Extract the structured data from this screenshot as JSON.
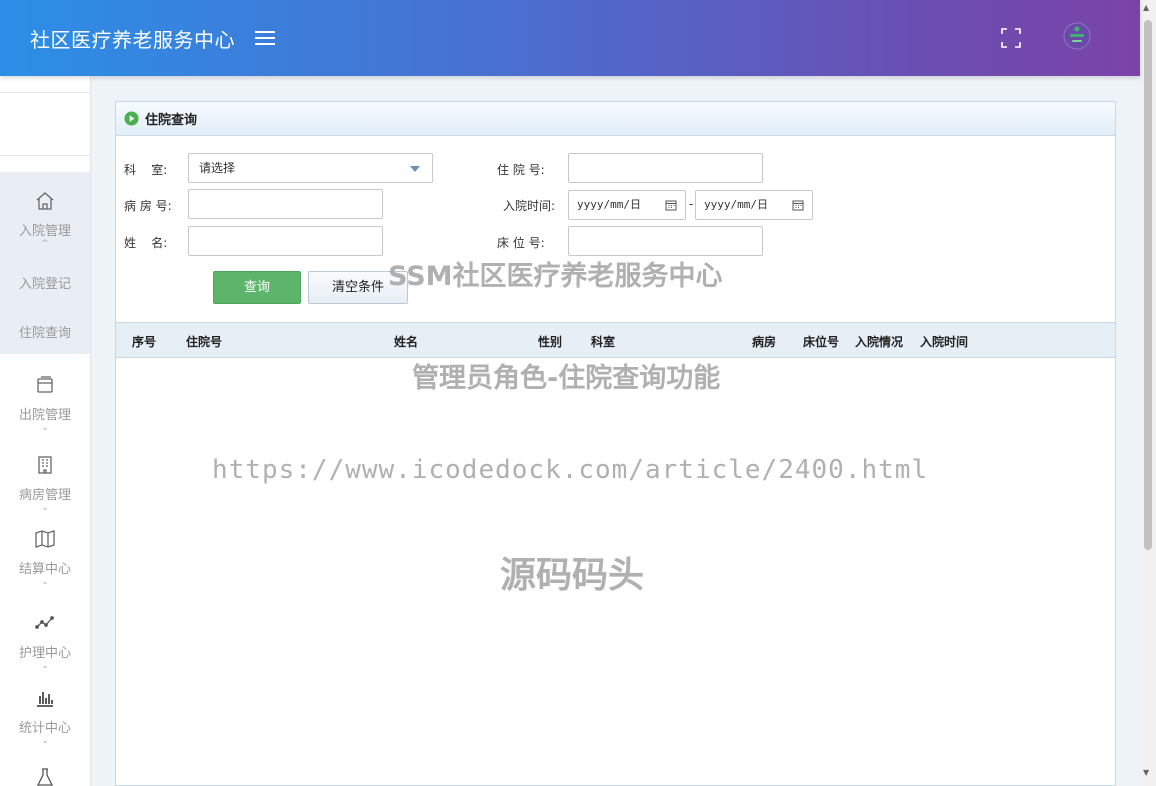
{
  "header": {
    "app_title": "社区医疗养老服务中心"
  },
  "sidebar": {
    "groups": [
      {
        "label": "入院管理",
        "icon": "home-icon",
        "chevron": "^",
        "children": [
          "入院登记",
          "住院查询"
        ]
      },
      {
        "label": "出院管理",
        "icon": "window-icon",
        "chevron": "⌄"
      },
      {
        "label": "病房管理",
        "icon": "building-icon",
        "chevron": "⌄"
      },
      {
        "label": "结算中心",
        "icon": "map-icon",
        "chevron": "⌄"
      },
      {
        "label": "护理中心",
        "icon": "line-chart-icon",
        "chevron": "⌄"
      },
      {
        "label": "统计中心",
        "icon": "bar-chart-icon",
        "chevron": "⌄"
      },
      {
        "label": "",
        "icon": "flask-icon"
      }
    ]
  },
  "panel": {
    "title": "住院查询"
  },
  "form": {
    "department_label": "科    室:",
    "department_value": "请选择",
    "admission_no_label": "住 院 号:",
    "ward_no_label": "病 房 号:",
    "admission_time_label": "入院时间:",
    "date_start_placeholder": "yyyy/mm/日",
    "date_end_placeholder": "yyyy/mm/日",
    "date_separator": "-",
    "name_label": "姓    名:",
    "bed_no_label": "床 位 号:",
    "query_button": "查询",
    "clear_button": "清空条件"
  },
  "table": {
    "columns": [
      "序号",
      "住院号",
      "姓名",
      "性别",
      "科室",
      "病房",
      "床位号",
      "入院情况",
      "入院时间"
    ]
  },
  "watermarks": {
    "line1": "SSM社区医疗养老服务中心",
    "line2": "管理员角色-住院查询功能",
    "line3": "https://www.icodedock.com/article/2400.html",
    "line4": "源码码头"
  }
}
